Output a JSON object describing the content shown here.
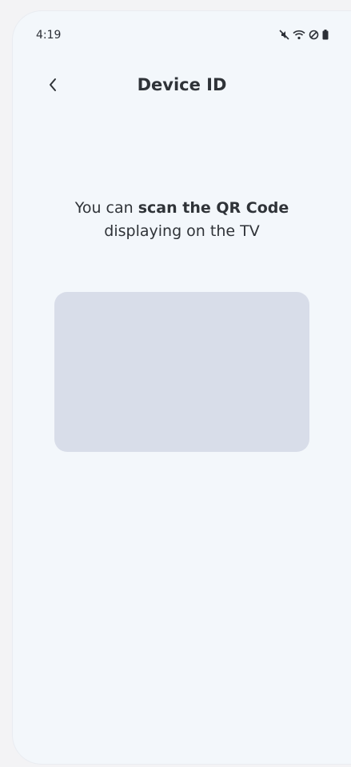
{
  "status_bar": {
    "time": "4:19",
    "icons": [
      "mute-icon",
      "wifi-icon",
      "dnd-icon",
      "battery-icon"
    ]
  },
  "header": {
    "back_icon": "chevron-left-icon",
    "title": "Device ID"
  },
  "instruction": {
    "prefix": "You can ",
    "bold": "scan the QR Code",
    "line2": "displaying on the TV"
  },
  "colors": {
    "background": "#f3f7fb",
    "scanner_placeholder": "#d8dde9",
    "text": "#2f3338"
  }
}
